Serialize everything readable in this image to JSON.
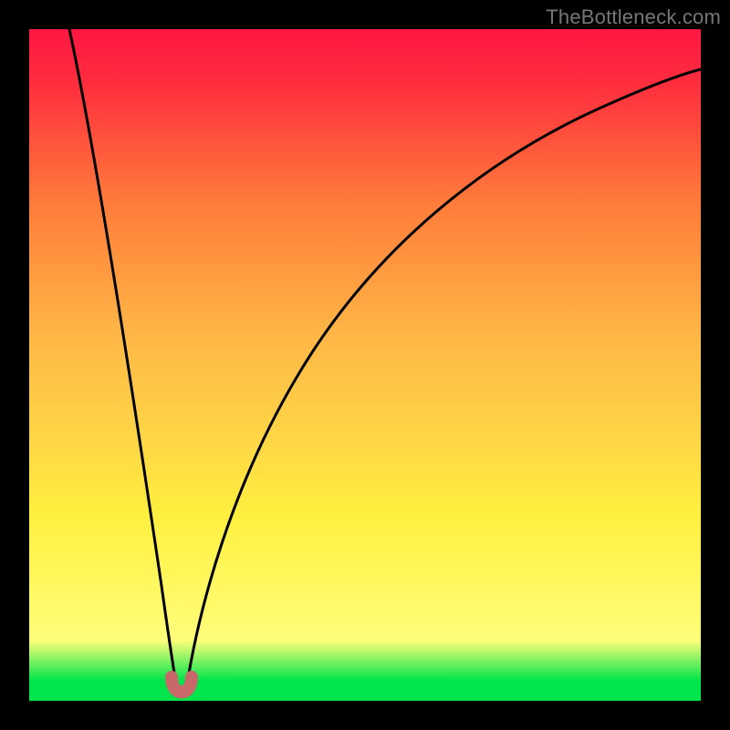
{
  "watermark": "TheBottleneck.com",
  "chart_data": {
    "type": "line",
    "title": "",
    "xlabel": "",
    "ylabel": "",
    "xlim": [
      0,
      100
    ],
    "ylim": [
      0,
      100
    ],
    "grid": false,
    "legend": false,
    "x_notch": 22,
    "curve_is_v_shape": true,
    "description": "V-shaped absolute-deviation curve minimized near x≈22",
    "series": [
      {
        "name": "left-branch",
        "x": [
          6,
          10,
          14,
          18,
          20,
          21,
          22
        ],
        "values": [
          100,
          75,
          50,
          25,
          10,
          3,
          0
        ]
      },
      {
        "name": "right-branch",
        "x": [
          22,
          24,
          28,
          34,
          44,
          58,
          76,
          92,
          100
        ],
        "values": [
          0,
          10,
          28,
          45,
          62,
          76,
          87,
          94,
          97
        ]
      }
    ],
    "valley_marker": {
      "x": 22,
      "y": 0,
      "shape": "u",
      "color": "#c9686b"
    },
    "background_gradient_stops": [
      "#00e64a",
      "#fffe7a",
      "#ffd846",
      "#ff7c3a",
      "#ff1742"
    ]
  }
}
